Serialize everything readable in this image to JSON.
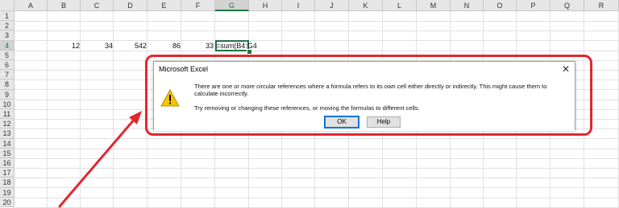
{
  "spreadsheet": {
    "columns": [
      "A",
      "B",
      "C",
      "D",
      "E",
      "F",
      "G",
      "H",
      "I",
      "J",
      "K",
      "L",
      "M",
      "N",
      "O",
      "P",
      "Q",
      "R"
    ],
    "selected_column": "G",
    "rows": [
      "1",
      "2",
      "3",
      "4",
      "5",
      "6",
      "7",
      "8",
      "9",
      "10",
      "11",
      "12",
      "13",
      "14",
      "15",
      "16",
      "17",
      "18",
      "19",
      "20"
    ],
    "selected_row": "4",
    "row4_values": {
      "B": "12",
      "C": "34",
      "D": "542",
      "E": "86",
      "F": "33"
    },
    "active_cell_formula": "=sum(B4:G4"
  },
  "dialog": {
    "title": "Microsoft Excel",
    "close_glyph": "✕",
    "message_line1": "There are one or more circular references where a formula refers to its own cell either directly or indirectly. This might cause them to calculate incorrectly.",
    "message_line2": "Try removing or changing these references, or moving the formulas to different cells.",
    "ok_label": "OK",
    "help_label": "Help",
    "icon": "warning-icon"
  },
  "colors": {
    "highlight": "#e0282e",
    "excel_green": "#217346",
    "warning_yellow": "#f5c400"
  }
}
